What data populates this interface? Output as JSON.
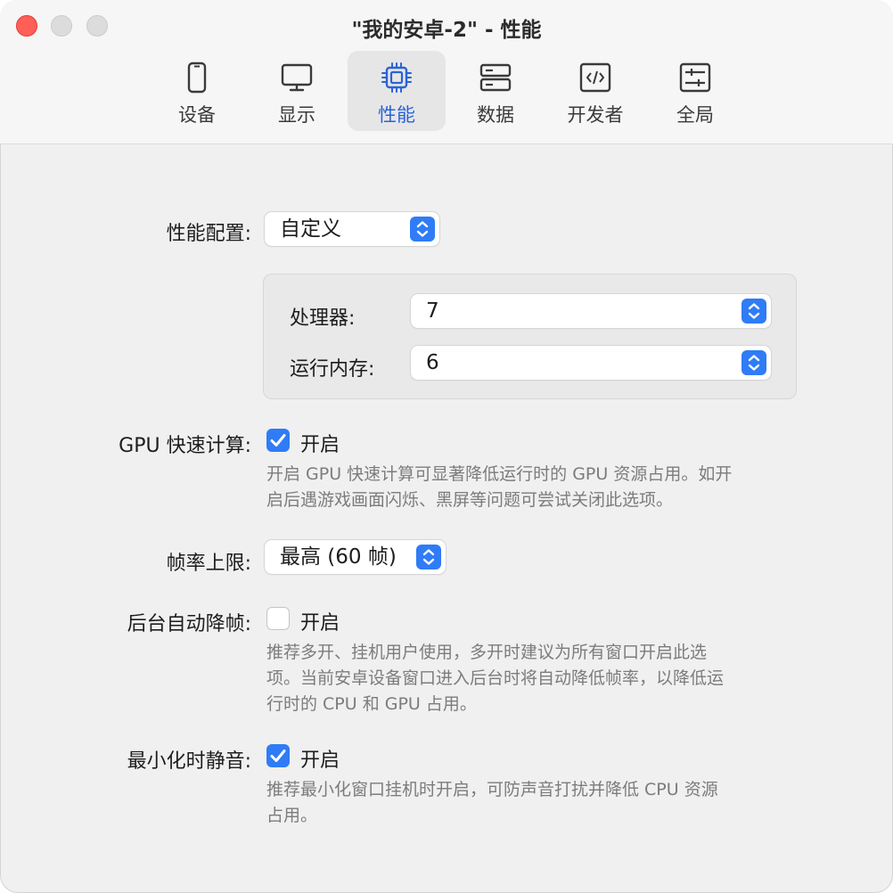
{
  "window": {
    "title": "\"我的安卓-2\" - 性能"
  },
  "tabs": [
    {
      "label": "设备",
      "icon": "phone-icon"
    },
    {
      "label": "显示",
      "icon": "monitor-icon"
    },
    {
      "label": "性能",
      "icon": "chip-icon",
      "active": true
    },
    {
      "label": "数据",
      "icon": "storage-icon"
    },
    {
      "label": "开发者",
      "icon": "code-icon"
    },
    {
      "label": "全局",
      "icon": "sliders-icon"
    }
  ],
  "performance": {
    "profile_label": "性能配置:",
    "profile_value": "自定义",
    "cpu_label": "处理器:",
    "cpu_value": "7",
    "memory_label": "运行内存:",
    "memory_value": "6"
  },
  "gpu": {
    "label": "GPU 快速计算:",
    "checkbox_label": "开启",
    "checked": true,
    "desc_line1": "开启 GPU 快速计算可显著降低运行时的 GPU 资源占用。如开",
    "desc_line2": "启后遇游戏画面闪烁、黑屏等问题可尝试关闭此选项。"
  },
  "framerate": {
    "label": "帧率上限:",
    "value": "最高 (60 帧)"
  },
  "background": {
    "label": "后台自动降帧:",
    "checkbox_label": "开启",
    "checked": false,
    "desc_line1": "推荐多开、挂机用户使用，多开时建议为所有窗口开启此选",
    "desc_line2": "项。当前安卓设备窗口进入后台时将自动降低帧率，以降低运",
    "desc_line3": "行时的 CPU 和 GPU 占用。"
  },
  "mute": {
    "label": "最小化时静音:",
    "checkbox_label": "开启",
    "checked": true,
    "desc_line1": "推荐最小化窗口挂机时开启，可防声音打扰并降低 CPU 资源",
    "desc_line2": "占用。"
  },
  "colors": {
    "accent": "#2f7cf6",
    "active_tab_text": "#2a63d6",
    "close": "#fe5f57"
  }
}
